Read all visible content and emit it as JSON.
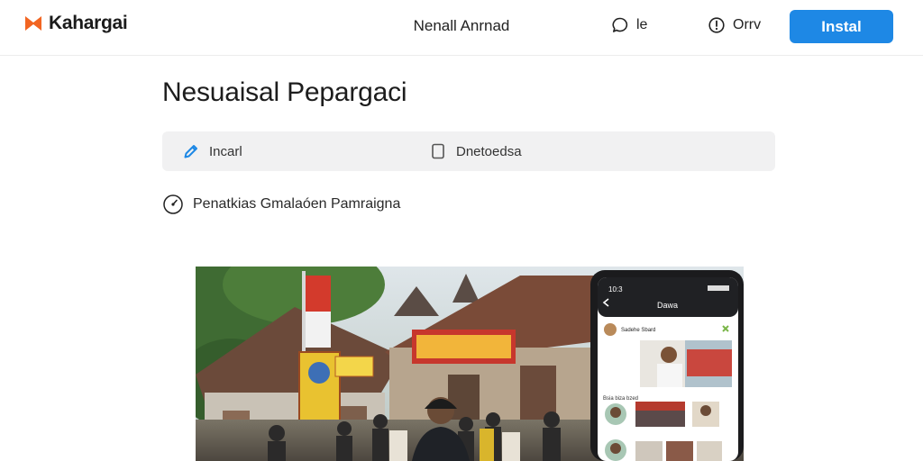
{
  "header": {
    "brand_name": "Kahargai",
    "center_title": "Nenall Anrnad",
    "nav_items": [
      {
        "label": "le",
        "icon": "chat-bubble-icon"
      },
      {
        "label": "Orrv",
        "icon": "info-circle-icon"
      }
    ],
    "install_label": "Instal",
    "accent_color": "#1e88e5",
    "brand_color": "#f26522"
  },
  "main": {
    "title": "Nesuaisal Pepargaci",
    "toolbar": {
      "items": [
        {
          "label": "Incarl",
          "icon": "pencil-icon"
        },
        {
          "label": "Dnetoedsa",
          "icon": "document-icon"
        }
      ]
    },
    "info_text": "Penatkias Gmalaóen Pamraigna",
    "hero": {
      "phone_time": "10:3",
      "phone_screen_title": "Dawa",
      "phone_post_user": "Sadehe Sbard",
      "phone_list_label": "Bsia biza bzed"
    }
  }
}
